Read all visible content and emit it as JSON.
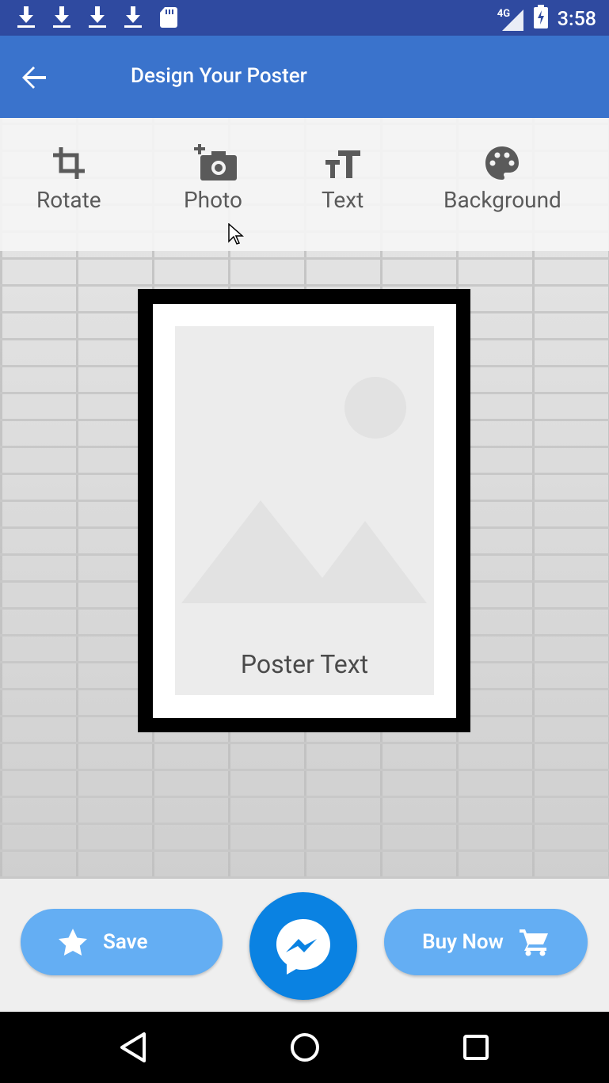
{
  "status_bar": {
    "time": "3:58",
    "network": "4G",
    "icons": [
      "download-icon",
      "download-icon",
      "download-icon",
      "download-icon",
      "sd-card-icon"
    ]
  },
  "app_bar": {
    "title": "Design Your Poster",
    "back_icon": "arrow-back-icon"
  },
  "toolbar": {
    "items": [
      {
        "label": "Rotate",
        "icon": "crop-rotate-icon"
      },
      {
        "label": "Photo",
        "icon": "add-photo-icon"
      },
      {
        "label": "Text",
        "icon": "text-size-icon"
      },
      {
        "label": "Background",
        "icon": "palette-icon"
      }
    ]
  },
  "poster": {
    "text": "Poster Text"
  },
  "actions": {
    "save_label": "Save",
    "buy_label": "Buy Now",
    "messenger_icon": "messenger-icon"
  },
  "colors": {
    "status_bar": "#2f4aa0",
    "app_bar": "#3a73cc",
    "pill": "#64aef3",
    "fab": "#0a82e2"
  }
}
